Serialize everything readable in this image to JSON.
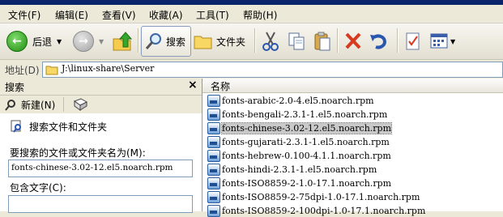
{
  "menu": [
    "文件(F)",
    "编辑(E)",
    "查看(V)",
    "收藏(A)",
    "工具(T)",
    "帮助(H)"
  ],
  "toolbar": {
    "back_label": "后退",
    "search_label": "搜索",
    "folders_label": "文件夹"
  },
  "address": {
    "label": "地址(D)",
    "path": "J:\\linux-share\\Server"
  },
  "search_pane": {
    "title": "搜索",
    "close": "×",
    "new_label": "新建(N)",
    "heading": "搜索文件和文件夹",
    "filename_label": "要搜索的文件或文件夹名为(M):",
    "filename_value": "fonts-chinese-3.02-12.el5.noarch.rpm",
    "contains_label": "包含文字(C):",
    "contains_value": ""
  },
  "files": {
    "column_name": "名称",
    "items": [
      {
        "name": "fonts-arabic-2.0-4.el5.noarch.rpm",
        "selected": false
      },
      {
        "name": "fonts-bengali-2.3.1-1.el5.noarch.rpm",
        "selected": false
      },
      {
        "name": "fonts-chinese-3.02-12.el5.noarch.rpm",
        "selected": true
      },
      {
        "name": "fonts-gujarati-2.3.1-1.el5.noarch.rpm",
        "selected": false
      },
      {
        "name": "fonts-hebrew-0.100-4.1.1.noarch.rpm",
        "selected": false
      },
      {
        "name": "fonts-hindi-2.3.1-1.el5.noarch.rpm",
        "selected": false
      },
      {
        "name": "fonts-ISO8859-2-1.0-17.1.noarch.rpm",
        "selected": false
      },
      {
        "name": "fonts-ISO8859-2-75dpi-1.0-17.1.noarch.rpm",
        "selected": false
      },
      {
        "name": "fonts-ISO8859-2-100dpi-1.0-17.1.noarch.rpm",
        "selected": false
      }
    ]
  },
  "colors": {
    "selection": "#c9c9c9",
    "back_arrow": "#1f8d12",
    "delete_x": "#d83a1f"
  }
}
